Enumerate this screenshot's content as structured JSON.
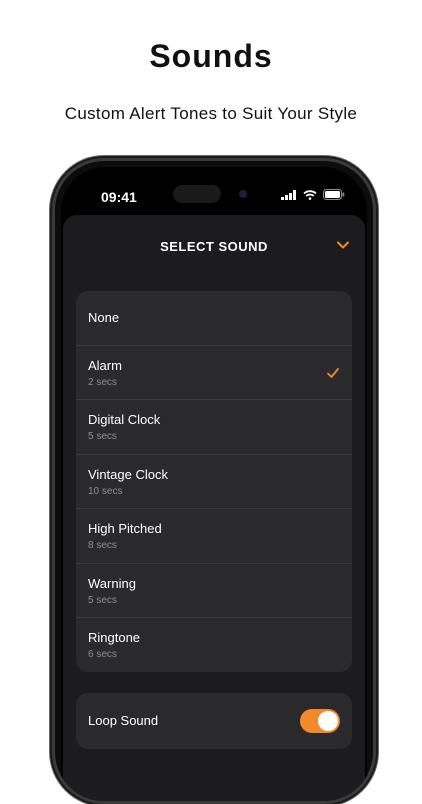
{
  "header": {
    "title": "Sounds",
    "subtitle": "Custom Alert Tones to Suit Your Style"
  },
  "status_bar": {
    "time": "09:41",
    "icons": [
      "signal-icon",
      "wifi-icon",
      "battery-icon"
    ]
  },
  "sheet": {
    "title": "SELECT SOUND",
    "collapse_icon": "chevron-down-icon",
    "accent_color": "#f08a2a"
  },
  "sounds": [
    {
      "name": "None",
      "duration": "",
      "selected": false
    },
    {
      "name": "Alarm",
      "duration": "2 secs",
      "selected": true
    },
    {
      "name": "Digital Clock",
      "duration": "5 secs",
      "selected": false
    },
    {
      "name": "Vintage Clock",
      "duration": "10 secs",
      "selected": false
    },
    {
      "name": "High Pitched",
      "duration": "8 secs",
      "selected": false
    },
    {
      "name": "Warning",
      "duration": "5 secs",
      "selected": false
    },
    {
      "name": "Ringtone",
      "duration": "6 secs",
      "selected": false
    }
  ],
  "loop": {
    "label": "Loop Sound",
    "enabled": true
  }
}
